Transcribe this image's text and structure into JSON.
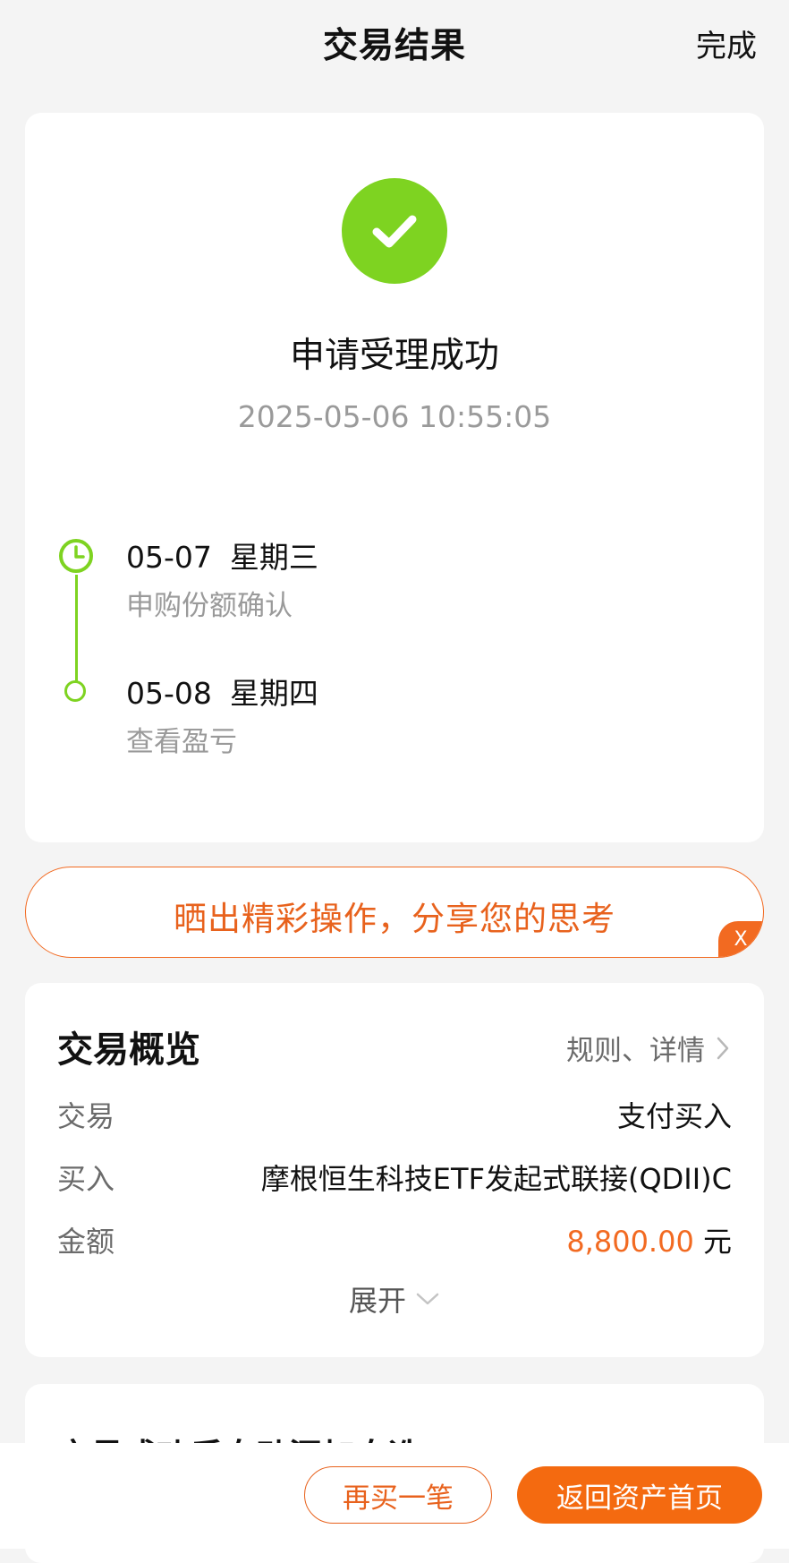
{
  "header": {
    "title": "交易结果",
    "done_label": "完成"
  },
  "result": {
    "status_icon": "check-circle-icon",
    "title": "申请受理成功",
    "timestamp": "2025-05-06 10:55:05",
    "timeline": [
      {
        "date": "05-07",
        "weekday": "星期三",
        "desc": "申购份额确认",
        "icon": "clock-icon"
      },
      {
        "date": "05-08",
        "weekday": "星期四",
        "desc": "查看盈亏",
        "icon": "dot-icon"
      }
    ]
  },
  "share_banner": {
    "text": "晒出精彩操作，分享您的思考",
    "close_label": "X"
  },
  "overview": {
    "title": "交易概览",
    "link_label": "规则、详情",
    "rows": [
      {
        "label": "交易",
        "value": "支付买入"
      },
      {
        "label": "买入",
        "value": "摩根恒生科技ETF发起式联接(QDII)C"
      },
      {
        "label": "金额",
        "amount": "8,800.00",
        "unit": "元"
      }
    ],
    "expand_label": "展开"
  },
  "next_card": {
    "title_partial": "交易成功后自动添加自选"
  },
  "bottom": {
    "buy_again_label": "再买一笔",
    "return_label": "返回资产首页"
  },
  "colors": {
    "accent": "#f26a21",
    "success": "#7ed321",
    "secondary_text": "#9a9a9a"
  }
}
